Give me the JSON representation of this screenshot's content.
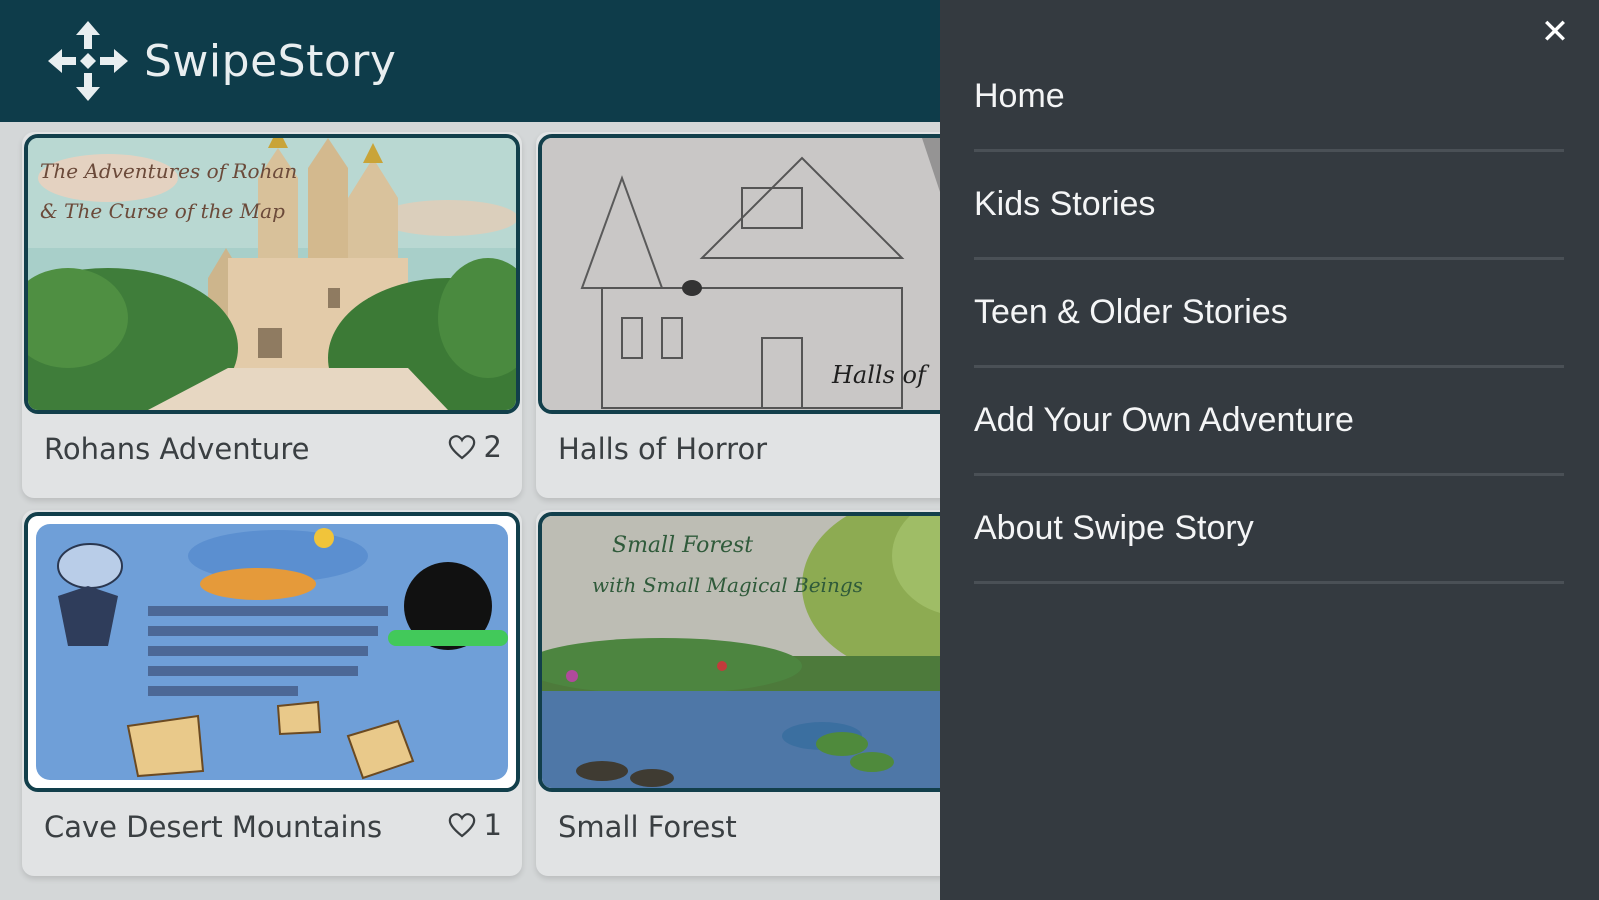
{
  "header": {
    "brand": "SwipeStory"
  },
  "stories": [
    {
      "title": "Rohans Adventure",
      "likes": "2",
      "thumb_text_1": "The Adventures of Rohan",
      "thumb_text_2": "& The Curse of the Map"
    },
    {
      "title": "Halls of Horror",
      "likes": "",
      "thumb_text_1": "Halls of",
      "thumb_text_2": ""
    },
    {
      "title": "Cave Desert Mountains",
      "likes": "1",
      "thumb_text_1": "",
      "thumb_text_2": ""
    },
    {
      "title": "Small Forest",
      "likes": "",
      "thumb_text_1": "Small Forest",
      "thumb_text_2": "with Small Magical Beings"
    }
  ],
  "menu": {
    "close_label": "✕",
    "items": [
      {
        "label": "Home"
      },
      {
        "label": "Kids Stories"
      },
      {
        "label": "Teen & Older Stories"
      },
      {
        "label": "Add Your Own Adventure"
      },
      {
        "label": "About Swipe Story"
      }
    ]
  },
  "colors": {
    "header_bg": "#0e3c4a",
    "menu_bg": "#343a40",
    "card_border": "#123f4b"
  },
  "icons": {
    "logo": "four-way-arrows-icon",
    "like": "heart-outline-icon",
    "close": "close-icon"
  }
}
